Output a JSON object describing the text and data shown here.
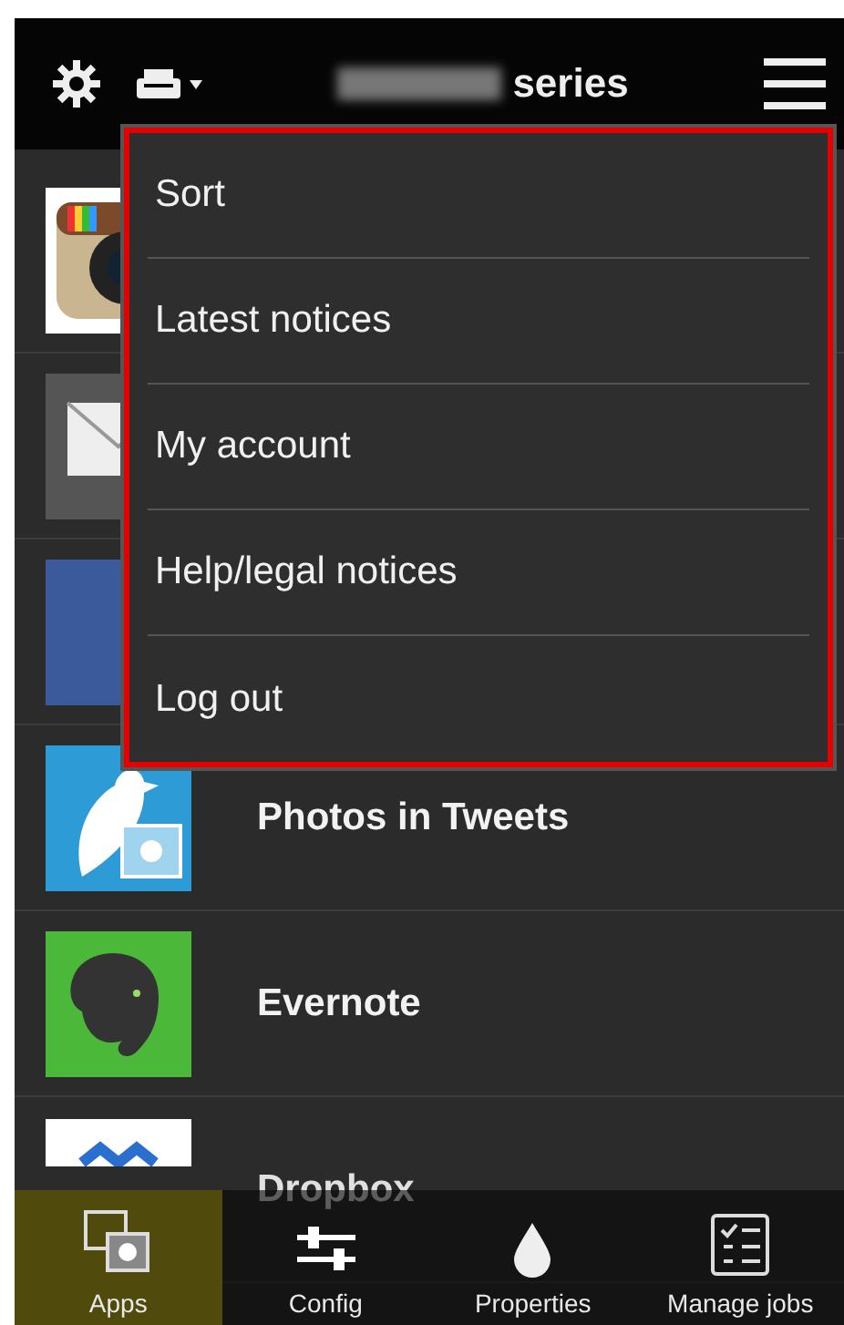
{
  "header": {
    "title": "series"
  },
  "apps": [
    {
      "kind": "camera"
    },
    {
      "kind": "mail"
    },
    {
      "kind": "blue"
    },
    {
      "kind": "bird",
      "name": "Photos in Tweets"
    },
    {
      "kind": "elephant",
      "name": "Evernote"
    },
    {
      "kind": "box",
      "name": "Dropbox"
    }
  ],
  "menu": {
    "items": [
      {
        "label": "Sort"
      },
      {
        "label": "Latest notices"
      },
      {
        "label": "My account"
      },
      {
        "label": "Help/legal notices"
      },
      {
        "label": "Log out"
      }
    ]
  },
  "tabs": [
    {
      "label": "Apps",
      "kind": "apps",
      "selected": true
    },
    {
      "label": "Config",
      "kind": "config",
      "selected": false
    },
    {
      "label": "Properties",
      "kind": "drop",
      "selected": false
    },
    {
      "label": "Manage jobs",
      "kind": "jobs",
      "selected": false
    }
  ]
}
